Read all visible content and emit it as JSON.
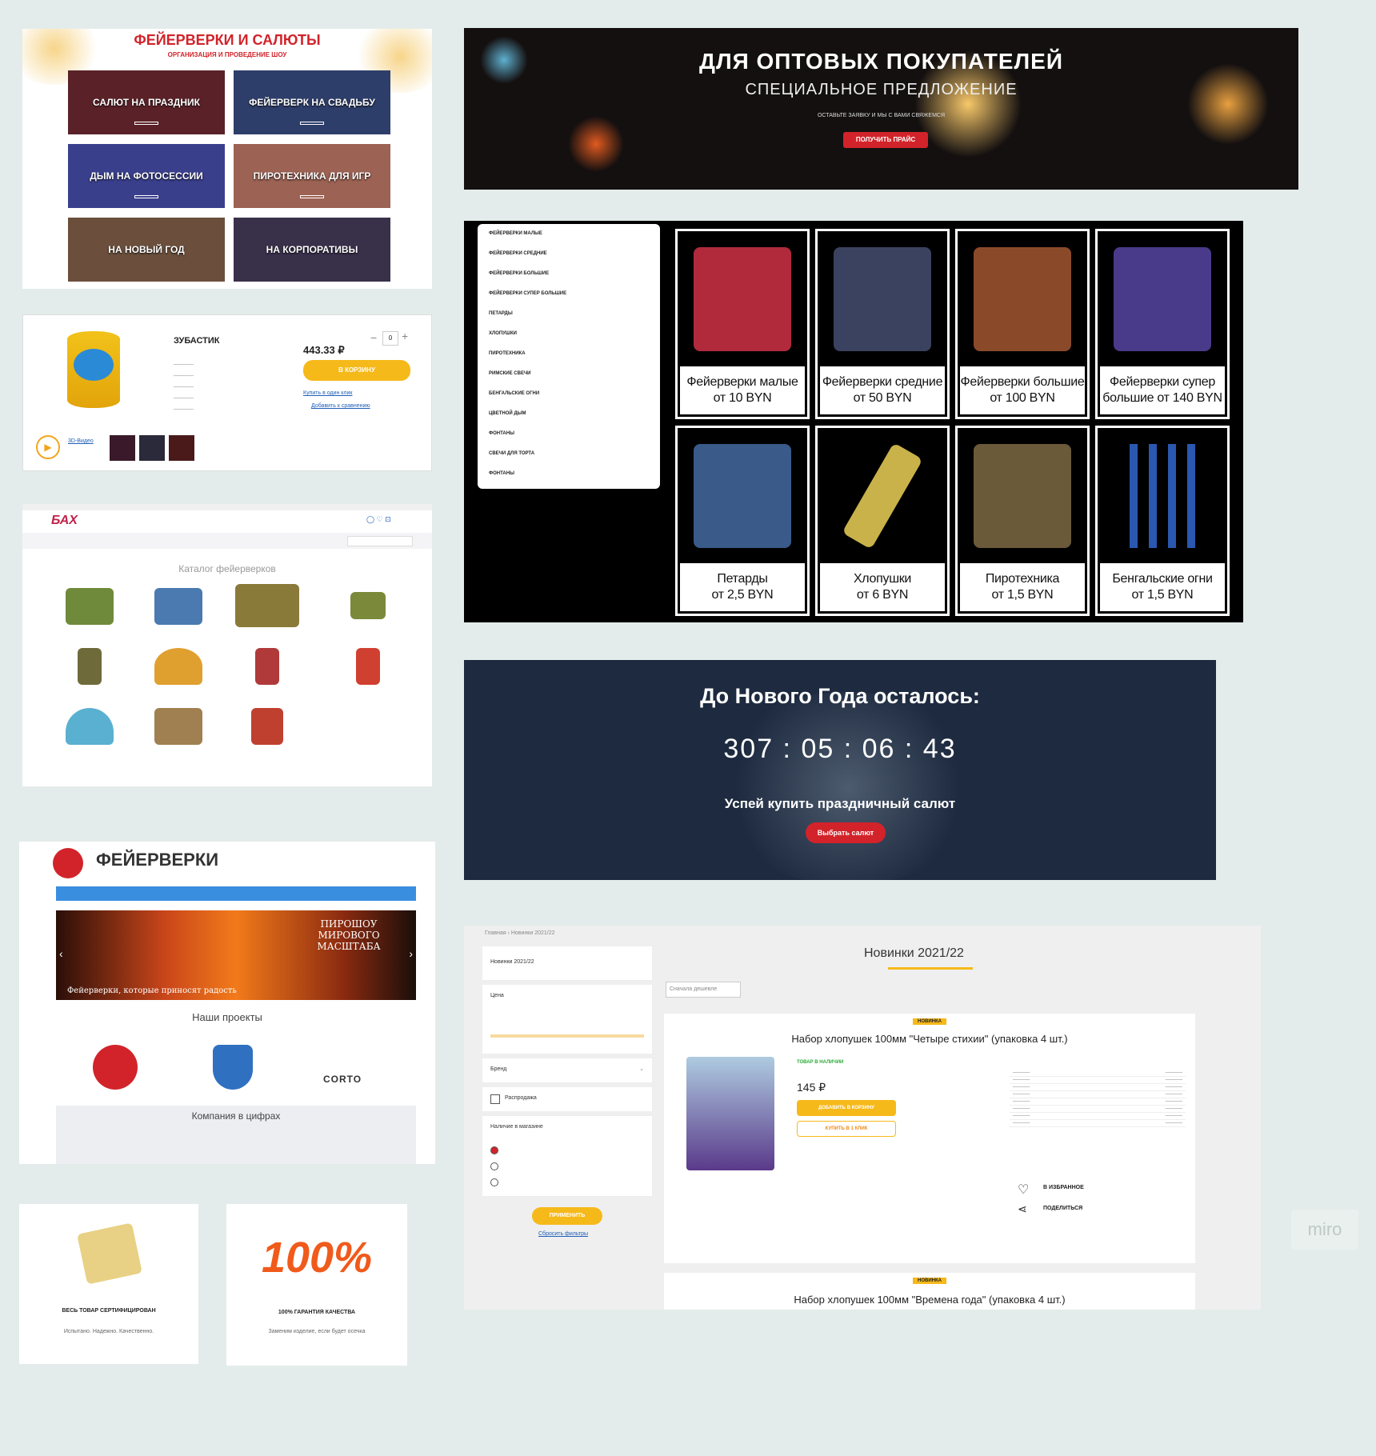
{
  "panel1": {
    "title": "ФЕЙЕРВЕРКИ И САЛЮТЫ",
    "subtitle": "ОРГАНИЗАЦИЯ И ПРОВЕДЕНИЕ ШОУ",
    "tiles": [
      {
        "label": "САЛЮТ НА ПРАЗДНИК",
        "color": "#5a2228"
      },
      {
        "label": "ФЕЙЕРВЕРК НА СВАДЬБУ",
        "color": "#2e3e6a"
      },
      {
        "label": "ДЫМ НА ФОТОСЕССИИ",
        "color": "#3a3f8c"
      },
      {
        "label": "ПИРОТЕХНИКА ДЛЯ ИГР",
        "color": "#9c6254"
      },
      {
        "label": "НА НОВЫЙ ГОД",
        "color": "#6b4f3c"
      },
      {
        "label": "НА КОРПОРАТИВЫ",
        "color": "#39304a"
      }
    ]
  },
  "panel2": {
    "product_name": "ЗУБАСТИК",
    "price": "443.33 ₽",
    "cart_label": "В КОРЗИНУ",
    "qty": "0"
  },
  "panel3": {
    "logo": "БАХ",
    "section_title": "Каталог фейерверков"
  },
  "panel4": {
    "logo": "ФЕЙЕРВЕРКИ",
    "slide_text": "ПИРОШОУ МИРОВОГО МАСШТАБА",
    "slide_caption": "Фейерверки, которые приносят радость",
    "projects_title": "Наши проекты",
    "project_brand": "CORTO",
    "numbers_title": "Компания в цифрах"
  },
  "panel5": {
    "title": "ВЕСЬ ТОВАР СЕРТИФИЦИРОВАН",
    "text": "Испытано. Надежно. Качественно."
  },
  "panel6": {
    "big": "100%",
    "title": "100% ГАРАНТИЯ КАЧЕСТВА",
    "text": "Заменим изделие, если будет осечка"
  },
  "banner": {
    "title": "ДЛЯ ОПТОВЫХ ПОКУПАТЕЛЕЙ",
    "subtitle": "СПЕЦИАЛЬНОЕ ПРЕДЛОЖЕНИЕ",
    "note": "ОСТАВЬТЕ ЗАЯВКУ И МЫ С ВАМИ СВЯЖЕМСЯ",
    "button": "ПОЛУЧИТЬ ПРАЙС"
  },
  "catalog": {
    "menu": [
      "ФЕЙЕРВЕРКИ МАЛЫЕ",
      "ФЕЙЕРВЕРКИ СРЕДНИЕ",
      "ФЕЙЕРВЕРКИ БОЛЬШИЕ",
      "ФЕЙЕРВЕРКИ СУПЕР БОЛЬШИЕ",
      "ПЕТАРДЫ",
      "ХЛОПУШКИ",
      "ПИРОТЕХНИКА",
      "РИМСКИЕ СВЕЧИ",
      "БЕНГАЛЬСКИЕ ОГНИ",
      "ЦВЕТНОЙ ДЫМ",
      "ФОНТАНЫ",
      "СВЕЧИ ДЛЯ ТОРТА",
      "ФОНТАНЫ"
    ],
    "products": [
      {
        "l1": "Фейерверки малые",
        "l2": "от 10 BYN",
        "color": "#b02a3c"
      },
      {
        "l1": "Фейерверки средние",
        "l2": "от 50 BYN",
        "color": "#3b4260"
      },
      {
        "l1": "Фейерверки большие",
        "l2": "от 100 BYN",
        "color": "#8a4a2a"
      },
      {
        "l1": "Фейерверки супер",
        "l2": "большие от 140 BYN",
        "color": "#4a3a8a"
      },
      {
        "l1": "Петарды",
        "l2": "от 2,5 BYN",
        "color": "#3a5a8a"
      },
      {
        "l1": "Хлопушки",
        "l2": "от 6 BYN",
        "color": "#c9b24a"
      },
      {
        "l1": "Пиротехника",
        "l2": "от 1,5 BYN",
        "color": "#6a5a3a"
      },
      {
        "l1": "Бенгальские огни",
        "l2": "от 1,5 BYN",
        "color": "#2a58b0"
      }
    ]
  },
  "countdown": {
    "title": "До Нового Года осталось:",
    "days": "307",
    "hours": "05",
    "minutes": "06",
    "seconds": "43",
    "tagline": "Успей купить праздничный салют",
    "button": "Выбрать салют"
  },
  "novelties": {
    "title": "Новинки 2021/22",
    "breadcrumb": "Главная › Новинки 2021/22",
    "filter_heading": "Новинки 2021/22",
    "filter_price": "Цена",
    "filter_brand": "Бренд",
    "filter_sale": "Распродажа",
    "filter_stock": "Наличие в магазине",
    "apply": "ПРИМЕНИТЬ",
    "reset": "Сбросить фильтры",
    "sort": "Сначала дешевле",
    "badge": "НОВИНКА",
    "product1": "Набор хлопушек 100мм \"Четыре стихии\" (упаковка 4 шт.)",
    "price": "145 ₽",
    "in_stock": "ТОВАР В НАЛИЧИИ",
    "add_cart": "ДОБАВИТЬ В КОРЗИНУ",
    "buy_one": "КУПИТЬ В 1 КЛИК",
    "favorite": "В ИЗБРАННОЕ",
    "share": "ПОДЕЛИТЬСЯ",
    "product2": "Набор хлопушек 100мм \"Времена года\" (упаковка 4 шт.)"
  },
  "watermark": "miro"
}
